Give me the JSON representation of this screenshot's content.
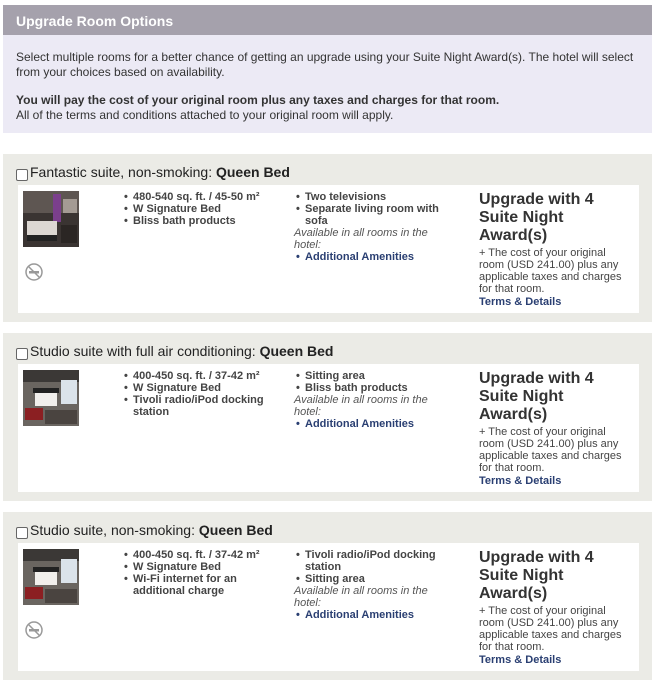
{
  "header": {
    "title": "Upgrade Room Options"
  },
  "intro": {
    "line1": "Select multiple rooms for a better chance of getting an upgrade using your Suite Night Award(s). The hotel will select from your choices based on availability.",
    "line2": "You will pay the cost of your original room plus any taxes and charges for that room.",
    "line3": "All of the terms and conditions attached to your original room will apply."
  },
  "rooms": [
    {
      "name": "Fantastic suite, non-smoking: ",
      "bed": "Queen Bed",
      "features_col1": [
        "480-540 sq. ft. / 45-50 m²",
        "W Signature Bed",
        "Bliss bath products"
      ],
      "features_col2": [
        "Two televisions",
        "Separate living room with sofa"
      ],
      "avail_note": "Available in all rooms in the hotel:",
      "amenities_link": "Additional Amenities",
      "upgrade_title": "Upgrade with 4 Suite Night Award(s)",
      "cost_note": "+ The cost of your original room (USD 241.00) plus any applicable taxes and charges for that room.",
      "terms_link": "Terms & Details"
    },
    {
      "name": "Studio suite with full air conditioning: ",
      "bed": "Queen Bed",
      "features_col1": [
        "400-450 sq. ft. / 37-42 m²",
        "W Signature Bed",
        "Tivoli radio/iPod docking station"
      ],
      "features_col2": [
        "Sitting area",
        "Bliss bath products"
      ],
      "avail_note": "Available in all rooms in the hotel:",
      "amenities_link": "Additional Amenities",
      "upgrade_title": "Upgrade with 4 Suite Night Award(s)",
      "cost_note": "+ The cost of your original room (USD 241.00) plus any applicable taxes and charges for that room.",
      "terms_link": "Terms & Details"
    },
    {
      "name": "Studio suite, non-smoking: ",
      "bed": "Queen Bed",
      "features_col1": [
        "400-450 sq. ft. / 37-42 m²",
        "W Signature Bed",
        "Wi-Fi internet for an additional charge"
      ],
      "features_col2": [
        "Tivoli radio/iPod docking station",
        "Sitting area"
      ],
      "avail_note": "Available in all rooms in the hotel:",
      "amenities_link": "Additional Amenities",
      "upgrade_title": "Upgrade with 4 Suite Night Award(s)",
      "cost_note": "+ The cost of your original room (USD 241.00) plus any applicable taxes and charges for that room.",
      "terms_link": "Terms & Details"
    }
  ]
}
